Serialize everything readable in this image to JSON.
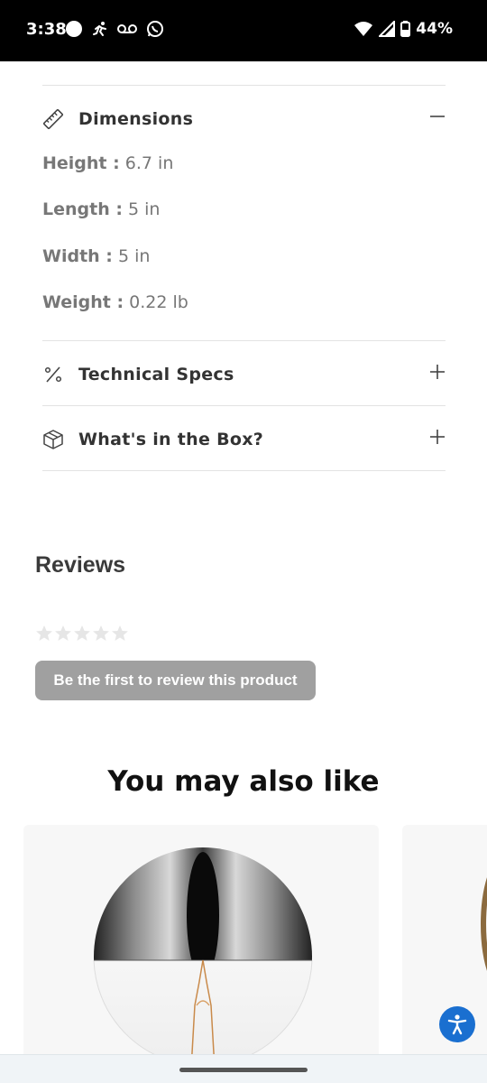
{
  "status_bar": {
    "time": "3:38",
    "battery": "44%",
    "left_icons": [
      "circle-icon",
      "running-icon",
      "voicemail-icon",
      "whatsapp-icon"
    ],
    "right_icons": [
      "wifi-icon",
      "signal-icon",
      "battery-icon"
    ]
  },
  "accordion": {
    "dimensions": {
      "title": "Dimensions",
      "toggle": "minus",
      "specs": [
        {
          "label": "Height :",
          "value": "6.7 in"
        },
        {
          "label": "Length :",
          "value": "5 in"
        },
        {
          "label": "Width :",
          "value": "5 in"
        },
        {
          "label": "Weight :",
          "value": "0.22 lb"
        }
      ]
    },
    "technical": {
      "title": "Technical Specs",
      "toggle": "plus"
    },
    "box": {
      "title": "What's in the Box?",
      "toggle": "plus"
    }
  },
  "reviews": {
    "title": "Reviews",
    "rating": 0,
    "max_rating": 5,
    "cta": "Be the first to review this product"
  },
  "recommendations": {
    "title": "You may also like"
  },
  "colors": {
    "accent_blue": "#1a6fd0",
    "button_gray": "#a0a0a0"
  }
}
